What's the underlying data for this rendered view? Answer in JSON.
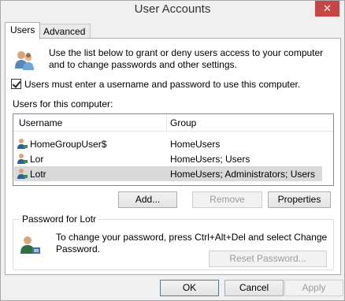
{
  "window": {
    "title": "User Accounts",
    "close_glyph": "✕"
  },
  "tabs": [
    {
      "label": "Users"
    },
    {
      "label": "Advanced"
    }
  ],
  "intro_text": "Use the list below to grant or deny users access to your computer and to change passwords and other settings.",
  "require_login": {
    "label": "Users must enter a username and password to use this computer.",
    "checked": true
  },
  "users_section": {
    "label": "Users for this computer:",
    "columns": [
      "Username",
      "Group"
    ],
    "rows": [
      {
        "username": "HomeGroupUser$",
        "group": "HomeUsers",
        "selected": false
      },
      {
        "username": "Lor",
        "group": "HomeUsers; Users",
        "selected": false
      },
      {
        "username": "Lotr",
        "group": "HomeUsers; Administrators; Users",
        "selected": true
      }
    ]
  },
  "list_buttons": {
    "add": "Add...",
    "remove": "Remove",
    "properties": "Properties"
  },
  "password_group": {
    "legend": "Password for Lotr",
    "text": "To change your password, press Ctrl+Alt+Del and select Change Password.",
    "reset_button": "Reset Password..."
  },
  "dialog_buttons": {
    "ok": "OK",
    "cancel": "Cancel",
    "apply": "Apply"
  },
  "icons": {
    "users": "users-icon",
    "user_row": "user-icon",
    "password_user": "user-key-icon"
  },
  "colors": {
    "close_button": "#c74545",
    "selection": "#d9d9d9"
  }
}
